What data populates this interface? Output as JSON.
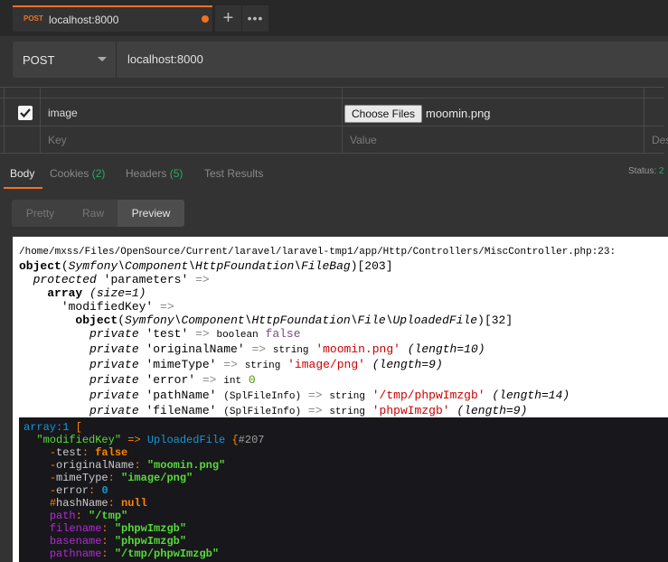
{
  "tab": {
    "method": "POST",
    "title": "localhost:8000"
  },
  "request": {
    "method": "POST",
    "url": "localhost:8000"
  },
  "form": {
    "row": {
      "key": "image",
      "choose_label": "Choose Files",
      "file": "moomin.png"
    },
    "placeholders": {
      "key": "Key",
      "value": "Value",
      "description": "Des"
    }
  },
  "response_tabs": [
    {
      "label": "Body"
    },
    {
      "label": "Cookies",
      "count": "(2)"
    },
    {
      "label": "Headers",
      "count": "(5)"
    },
    {
      "label": "Test Results"
    }
  ],
  "status": {
    "label": "Status:",
    "value": "2"
  },
  "view_modes": [
    "Pretty",
    "Raw",
    "Preview"
  ],
  "var_dump": {
    "path": "/home/mxss/Files/OpenSource/Current/laravel/laravel-tmp1/app/Http/Controllers/MiscController.php:23:",
    "object_kw": "object",
    "object_class": "Symfony\\Component\\HttpFoundation\\FileBag",
    "object_id": "[203]",
    "protected_kw": "protected",
    "parameters": "'parameters'",
    "array_kw": "array",
    "array_size": "(size=1)",
    "mod_key": "'modifiedKey'",
    "uploaded_class": "Symfony\\Component\\HttpFoundation\\File\\UploadedFile",
    "uploaded_id": "[32]",
    "arrow": "=>",
    "props": [
      {
        "name": "'test'",
        "type": "boolean",
        "value": "false",
        "kind": "bool",
        "extra": ""
      },
      {
        "name": "'originalName'",
        "type": "string",
        "value": "'moomin.png'",
        "kind": "str",
        "extra": "(length=10)"
      },
      {
        "name": "'mimeType'",
        "type": "string",
        "value": "'image/png'",
        "kind": "str",
        "extra": "(length=9)"
      },
      {
        "name": "'error'",
        "type": "int",
        "value": "0",
        "kind": "num",
        "extra": ""
      },
      {
        "name": "'pathName'",
        "prefix": "(SplFileInfo)",
        "type": "string",
        "value": "'/tmp/phpwImzgb'",
        "kind": "str",
        "extra": "(length=14)"
      },
      {
        "name": "'fileName'",
        "prefix": "(SplFileInfo)",
        "type": "string",
        "value": "'phpwImzgb'",
        "kind": "str",
        "extra": "(length=9)"
      }
    ]
  },
  "dump": {
    "header": "array:1",
    "key": "\"modifiedKey\"",
    "class": "UploadedFile",
    "ref": "#207",
    "lines": [
      {
        "sigil": "-",
        "name": "test",
        "value": "false",
        "vkind": "kw"
      },
      {
        "sigil": "-",
        "name": "originalName",
        "value": "\"moomin.png\"",
        "vkind": "str"
      },
      {
        "sigil": "-",
        "name": "mimeType",
        "value": "\"image/png\"",
        "vkind": "str"
      },
      {
        "sigil": "-",
        "name": "error",
        "value": "0",
        "vkind": "num"
      },
      {
        "sigil": "#",
        "name": "hashName",
        "value": "null",
        "vkind": "kw"
      },
      {
        "sigil": "",
        "name": "path",
        "value": "\"/tmp\"",
        "vkind": "str",
        "meta": true
      },
      {
        "sigil": "",
        "name": "filename",
        "value": "\"phpwImzgb\"",
        "vkind": "str",
        "meta": true
      },
      {
        "sigil": "",
        "name": "basename",
        "value": "\"phpwImzgb\"",
        "vkind": "str",
        "meta": true
      },
      {
        "sigil": "",
        "name": "pathname",
        "value": "\"/tmp/phpwImzgb\"",
        "vkind": "str",
        "meta": true
      }
    ]
  },
  "colors": {
    "accent": "#f47023",
    "count_green": "#29a86b",
    "bg": "#333333"
  }
}
